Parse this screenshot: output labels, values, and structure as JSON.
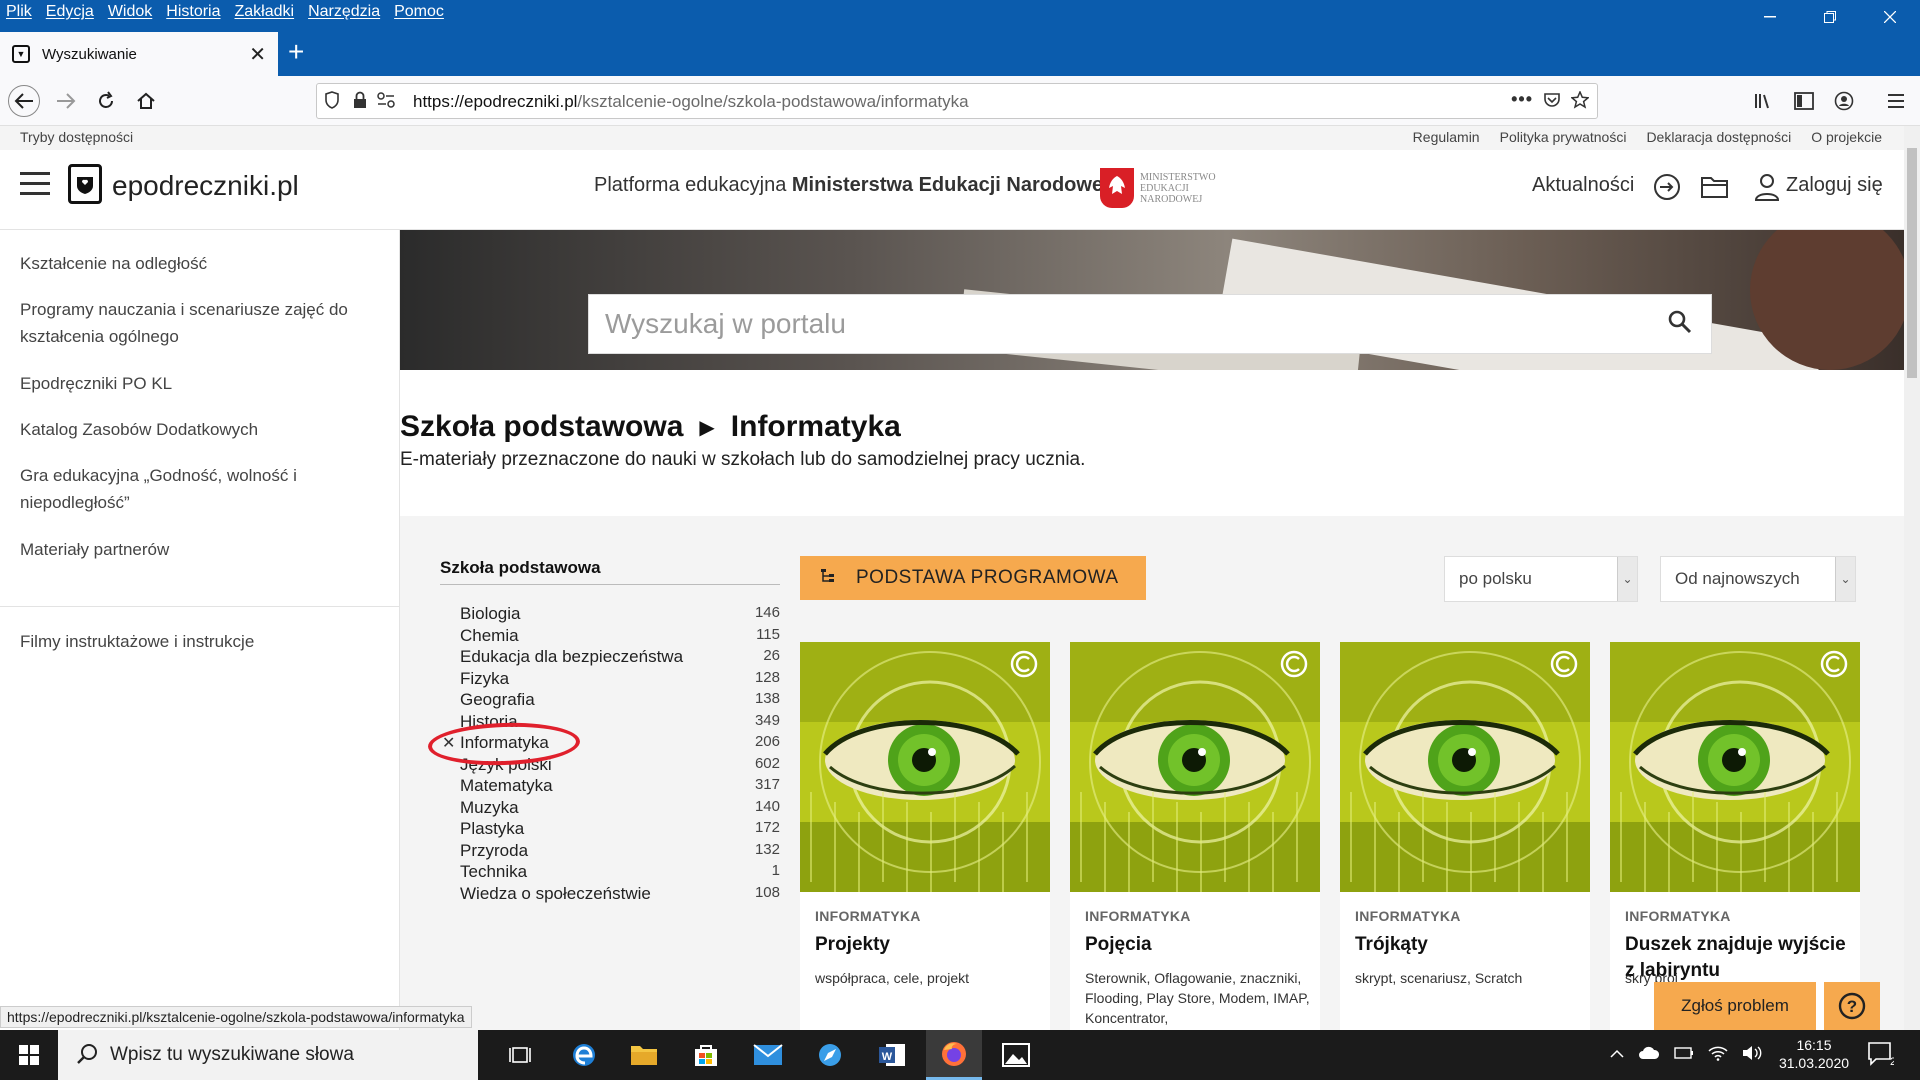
{
  "browser": {
    "menu": [
      "Plik",
      "Edycja",
      "Widok",
      "Historia",
      "Zakładki",
      "Narzędzia",
      "Pomoc"
    ],
    "tab_title": "Wyszukiwanie",
    "url_domain": "https://epodreczniki.pl",
    "url_path": "/ksztalcenie-ogolne/szkola-podstawowa/informatyka",
    "url_dots": "•••"
  },
  "accessibility_bar": {
    "modes": "Tryby dostępności",
    "links": [
      "Regulamin",
      "Polityka prywatności",
      "Deklaracja dostępności",
      "O projekcie"
    ]
  },
  "header": {
    "logo_text": "epodreczniki.pl",
    "platform_prefix": "Platforma edukacyjna ",
    "platform_bold": "Ministerstwa Edukacji Narodowej",
    "ministry_lines": [
      "MINISTERSTWO",
      "EDUKACJI",
      "NARODOWEJ"
    ],
    "news": "Aktualności",
    "login": "Zaloguj się"
  },
  "sidebar": {
    "items": [
      "Kształcenie na odległość",
      "Programy nauczania i scenariusze zajęć do kształcenia ogólnego",
      "Epodręczniki PO KL",
      "Katalog Zasobów Dodatkowych",
      "Gra edukacyjna „Godność, wolność i niepodległość”",
      "Materiały partnerów",
      "Filmy instruktażowe i instrukcje"
    ]
  },
  "search": {
    "placeholder": "Wyszukaj w portalu"
  },
  "breadcrumb": {
    "level1": "Szkoła podstawowa",
    "level2": "Informatyka",
    "subtitle": "E-materiały przeznaczone do nauki w szkołach lub do samodzielnej pracy ucznia."
  },
  "filters": {
    "title": "Szkoła podstawowa",
    "active_mark": "✕",
    "subjects": [
      {
        "name": "Biologia",
        "count": "146"
      },
      {
        "name": "Chemia",
        "count": "115"
      },
      {
        "name": "Edukacja dla bezpieczeństwa",
        "count": "26"
      },
      {
        "name": "Fizyka",
        "count": "128"
      },
      {
        "name": "Geografia",
        "count": "138"
      },
      {
        "name": "Historia",
        "count": "349"
      },
      {
        "name": "Informatyka",
        "count": "206"
      },
      {
        "name": "Język polski",
        "count": "602"
      },
      {
        "name": "Matematyka",
        "count": "317"
      },
      {
        "name": "Muzyka",
        "count": "140"
      },
      {
        "name": "Plastyka",
        "count": "172"
      },
      {
        "name": "Przyroda",
        "count": "132"
      },
      {
        "name": "Technika",
        "count": "1"
      },
      {
        "name": "Wiedza o społeczeństwie",
        "count": "108"
      }
    ]
  },
  "controls": {
    "podstawa": "PODSTAWA PROGRAMOWA",
    "language": "po polsku",
    "sort": "Od najnowszych"
  },
  "cards": [
    {
      "subject": "INFORMATYKA",
      "title": "Projekty",
      "tags": "współpraca, cele, projekt"
    },
    {
      "subject": "INFORMATYKA",
      "title": "Pojęcia",
      "tags": "Sterownik, Oflagowanie, znaczniki, Flooding, Play Store, Modem, IMAP, Koncentrator,"
    },
    {
      "subject": "INFORMATYKA",
      "title": "Trójkąty",
      "tags": "skrypt, scenariusz, Scratch"
    },
    {
      "subject": "INFORMATYKA",
      "title": "Duszek znajduje wyjście z labiryntu",
      "tags": "skry proj"
    }
  ],
  "floating": {
    "report": "Zgłoś problem",
    "help": "?"
  },
  "status_url": "https://epodreczniki.pl/ksztalcenie-ogolne/szkola-podstawowa/informatyka",
  "taskbar": {
    "search_placeholder": "Wpisz tu wyszukiwane słowa",
    "time": "16:15",
    "date": "31.03.2020",
    "notifications": "2"
  },
  "colors": {
    "accent_orange": "#f6a94e",
    "menubar_blue": "#0b5cad",
    "highlight_red": "#e0202c"
  }
}
